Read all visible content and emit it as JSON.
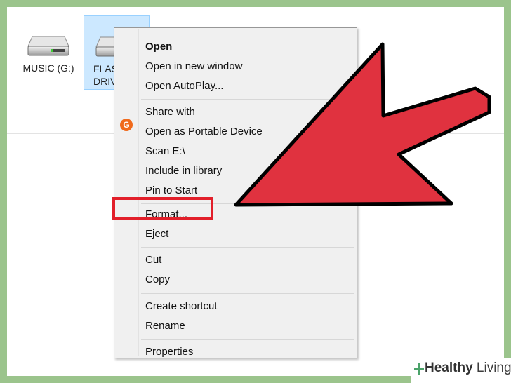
{
  "drives": [
    {
      "label": "MUSIC (G:)"
    },
    {
      "label": "FLAS\nDRIVE"
    }
  ],
  "context_menu": {
    "items": [
      {
        "label": "Open",
        "bold": true
      },
      {
        "label": "Open in new window"
      },
      {
        "label": "Open AutoPlay..."
      },
      {
        "label": "Share with"
      },
      {
        "label": "Open as Portable Device"
      },
      {
        "label": "Scan E:\\",
        "icon": "antivirus-icon"
      },
      {
        "label": "Include in library"
      },
      {
        "label": "Pin to Start"
      },
      {
        "label": "Format...",
        "highlighted": true
      },
      {
        "label": "Eject"
      },
      {
        "label": "Cut"
      },
      {
        "label": "Copy"
      },
      {
        "label": "Create shortcut"
      },
      {
        "label": "Rename"
      },
      {
        "label": "Properties"
      }
    ]
  },
  "watermark": {
    "brand_bold": "Healthy",
    "brand_rest": " Living"
  },
  "colors": {
    "frame": "#9bc48c",
    "arrow_fill": "#e0323f",
    "highlight_box": "#e21f2a",
    "selection": "#cce8ff"
  }
}
